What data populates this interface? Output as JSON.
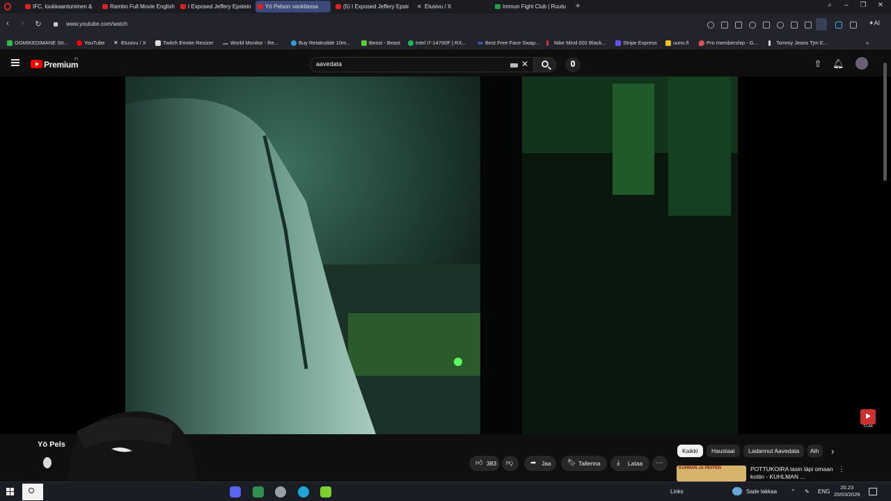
{
  "browser": {
    "tabs": [
      {
        "label": "IFC, loukkaantuminen &"
      },
      {
        "label": "Rambo Full Movie English"
      },
      {
        "label": "I Exposed Jeffery Epstein"
      },
      {
        "label": "Yö Pelson vankilassa",
        "active": true
      },
      {
        "label": "(5) I Exposed Jeffery Epste"
      },
      {
        "label": "Etusivu / X"
      },
      {
        "label": "Immun Fight Club | Ruutu"
      }
    ],
    "new_tab": "+",
    "url": "www.youtube.com/watch",
    "ai_label": "AI",
    "bookmarks": [
      {
        "label": "OGMIKEDIMANE Str...",
        "color": "#2dbb4e"
      },
      {
        "label": "YouTube",
        "color": "#ff0000"
      },
      {
        "label": "Etusivu / X",
        "color": "#ffffff"
      },
      {
        "label": "Twitch Emote Resizer",
        "color": "#dddddd"
      },
      {
        "label": "World Monitor - Re...",
        "color": "#888888"
      },
      {
        "label": "Buy Retatrutide 10m...",
        "color": "#2a9fd6"
      },
      {
        "label": "Beast - Beast",
        "color": "#55cc33"
      },
      {
        "label": "Intel i7-14700F | RX...",
        "color": "#1db954"
      },
      {
        "label": "Best Free Face Swap...",
        "color": "#3355aa"
      },
      {
        "label": "Nike Mind 002 Black...",
        "color": "#cc3333"
      },
      {
        "label": "Stripe Express",
        "color": "#6355ff"
      },
      {
        "label": "uuno.fi",
        "color": "#f5c518"
      },
      {
        "label": "Pro membership - G...",
        "color": "#e05050"
      },
      {
        "label": "Tommy Jeans Tjm E...",
        "color": "#dddddd"
      }
    ]
  },
  "youtube": {
    "logo_text": "Premium",
    "region": "FI",
    "search_value": "aavedata",
    "video_title": "Yö Pels",
    "like_count": "383",
    "actions": {
      "share": "Jaa",
      "save": "Tallenna",
      "download": "Lataa"
    },
    "chips": [
      "Kaikki",
      "Haustaai",
      "Ladannut Aavedata",
      "Aih"
    ],
    "recommendation": {
      "thumb_text": "KUHMAN JA PEFFEN",
      "title": "POTTUKOIRA lasin läpi omaan kotiin - KUHLMAN ..."
    },
    "watermark": "TILAA"
  },
  "taskbar": {
    "links_label": "Links",
    "weather": "Sade lakkaa",
    "language": "ENG",
    "time": "20.23",
    "date": "20/03/2026"
  },
  "colors": {
    "accent": "#ff0000",
    "active_tab": "#3b4a78"
  }
}
